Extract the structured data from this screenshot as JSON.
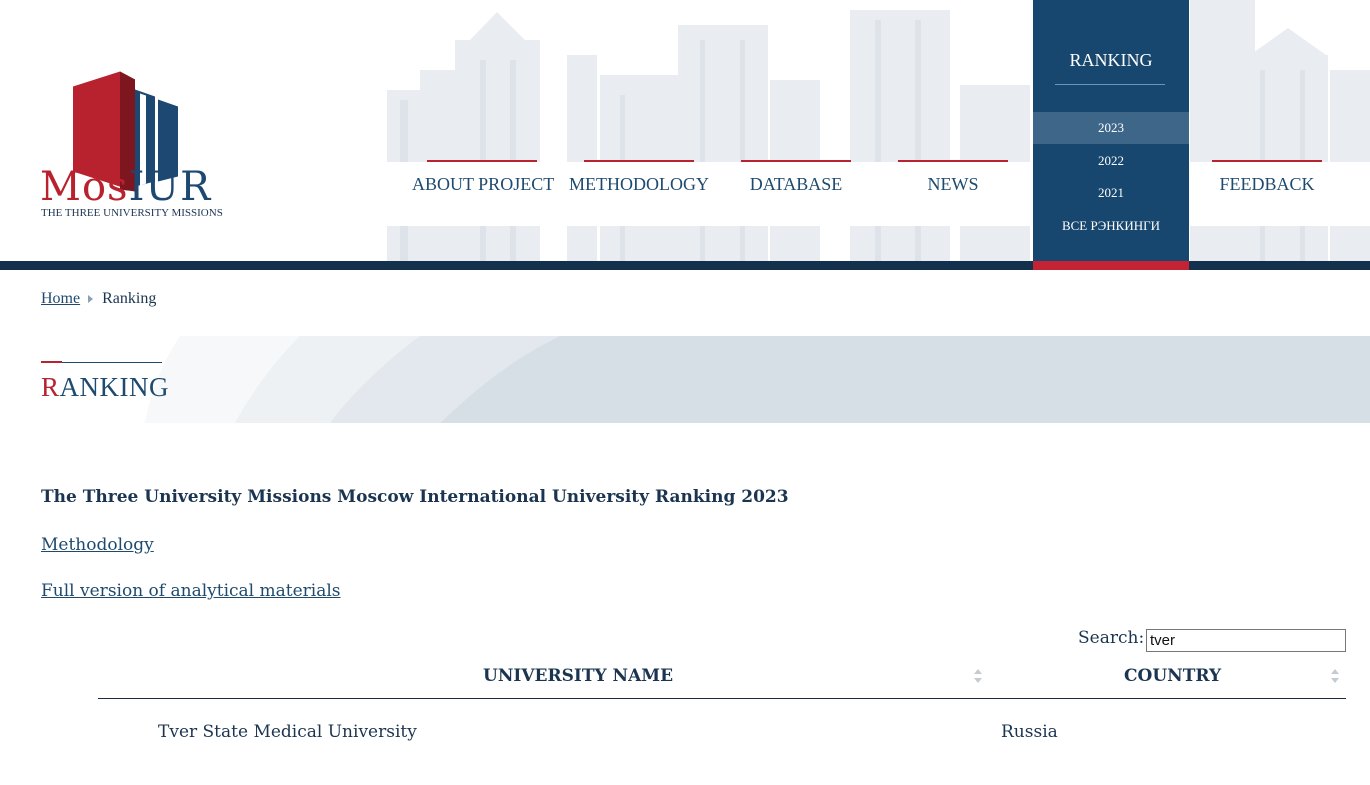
{
  "logo": {
    "mos": "Mos",
    "iur": "IUR",
    "subtitle": "THE THREE UNIVERSITY MISSIONS"
  },
  "nav": {
    "items": [
      {
        "label": "ABOUT PROJECT"
      },
      {
        "label": "METHODOLOGY"
      },
      {
        "label": "DATABASE"
      },
      {
        "label": "NEWS"
      },
      {
        "label": "FEEDBACK"
      }
    ],
    "ranking": {
      "label": "RANKING",
      "submenu": [
        "2023",
        "2022",
        "2021",
        "ВСЕ РЭНКИНГИ"
      ]
    }
  },
  "breadcrumb": {
    "home": "Home",
    "current": "Ranking"
  },
  "page": {
    "title_first": "R",
    "title_rest": "ANKING",
    "heading": "The Three University Missions Moscow International University Ranking 2023",
    "link_methodology": "Methodology",
    "link_full": "Full version of analytical materials"
  },
  "search": {
    "label": "Search:",
    "value": "tver"
  },
  "table": {
    "columns": [
      "UNIVERSITY NAME",
      "COUNTRY"
    ],
    "rows": [
      {
        "name": "Tver State Medical University",
        "country": "Russia"
      }
    ]
  },
  "colors": {
    "brand_red": "#b72330",
    "brand_blue": "#17476e",
    "dark_bar": "#13314c"
  }
}
